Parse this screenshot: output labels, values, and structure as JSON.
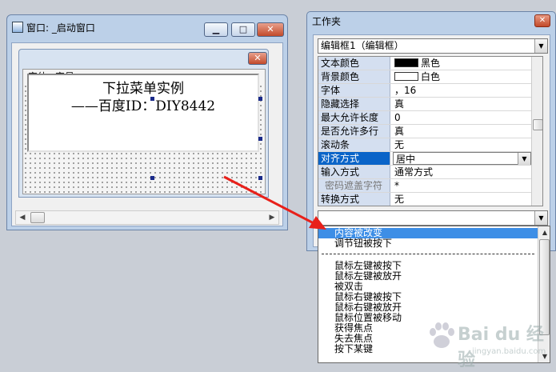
{
  "start_window": {
    "title": "窗口: _启动窗口",
    "min_glyph": "▁",
    "max_glyph": "□",
    "close_glyph": "✕"
  },
  "form": {
    "close_glyph": "✕",
    "menu": [
      "字体",
      "字号"
    ],
    "editbox_lines": [
      "下拉菜单实例",
      "——百度ID：DIY8442"
    ]
  },
  "toolbox": {
    "title": "工作夹",
    "close_glyph": "✕",
    "object_combo": "编辑框1（编辑框）",
    "properties": [
      {
        "key": "文本颜色",
        "value": "黑色",
        "swatch": "#000000"
      },
      {
        "key": "背景颜色",
        "value": "白色",
        "swatch": "#ffffff"
      },
      {
        "key": "字体",
        "value": "，16"
      },
      {
        "key": "隐藏选择",
        "value": "真"
      },
      {
        "key": "最大允许长度",
        "value": "0"
      },
      {
        "key": "是否允许多行",
        "value": "真"
      },
      {
        "key": "滚动条",
        "value": "无"
      },
      {
        "key": "对齐方式",
        "value": "居中",
        "selected": true
      },
      {
        "key": "输入方式",
        "value": "通常方式"
      },
      {
        "key": "密码遮盖字符",
        "value": "*",
        "dim": true
      },
      {
        "key": "转换方式",
        "value": "无"
      }
    ],
    "event_combo": ""
  },
  "event_list": {
    "items_top": [
      "内容被改变",
      "调节钮被按下"
    ],
    "items_bottom": [
      "鼠标左键被按下",
      "鼠标左键被放开",
      "被双击",
      "鼠标右键被按下",
      "鼠标右键被放开",
      "鼠标位置被移动",
      "获得焦点",
      "失去焦点",
      "按下某键"
    ],
    "selected_index": 0
  },
  "watermark": {
    "text": "Bai du 经验",
    "sub": "jingyan.baidu.com"
  },
  "colors": {
    "annotation_arrow": "#e8201a",
    "selection": "#0a64c8",
    "list_selection": "#3d8ee6"
  }
}
